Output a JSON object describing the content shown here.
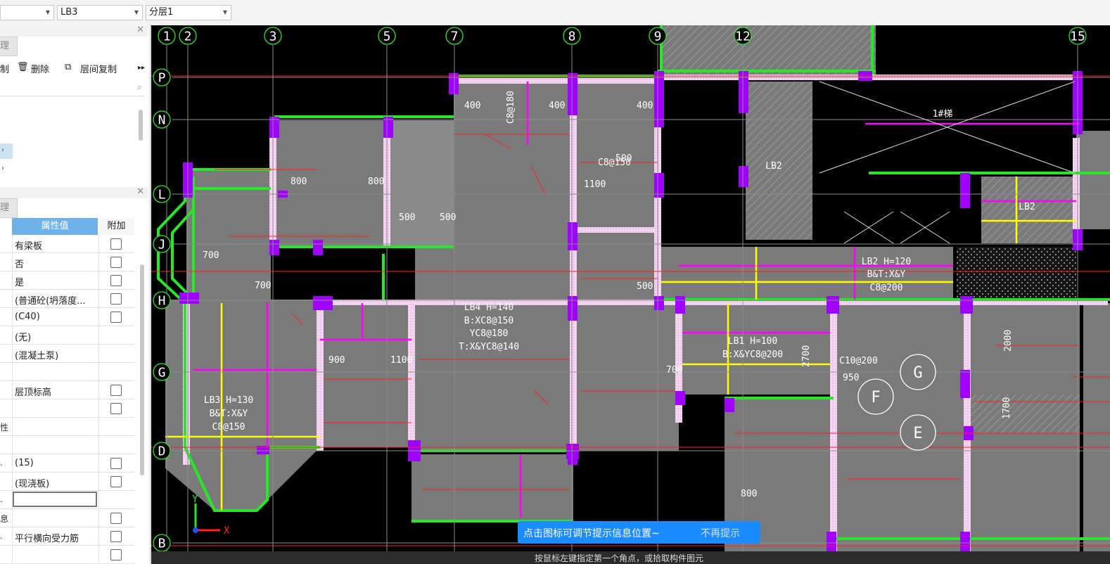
{
  "toolbar": {
    "dropdown1": "",
    "dropdown2": "LB3",
    "dropdown3": "分层1"
  },
  "left_panel": {
    "top_tab": "理",
    "actions": {
      "copy_partial": "制",
      "delete": "删除",
      "floor_copy": "层间复制"
    },
    "bottom_tab": "理",
    "grid_headers": {
      "value": "属性值",
      "extra": "附加"
    },
    "properties": [
      {
        "key": "",
        "value": "有梁板",
        "checkbox": true
      },
      {
        "key": "",
        "value": "否",
        "checkbox": true
      },
      {
        "key": "",
        "value": "是",
        "checkbox": true
      },
      {
        "key": "",
        "value": "(普通砼(坍落度...",
        "checkbox": true
      },
      {
        "key": "",
        "value": "(C40)",
        "checkbox": true
      },
      {
        "key": "",
        "value": "(无)",
        "checkbox": false
      },
      {
        "key": "",
        "value": "(混凝土泵)",
        "checkbox": false
      },
      {
        "key": "",
        "value": "",
        "checkbox": false
      },
      {
        "key": "",
        "value": "层顶标高",
        "checkbox": true
      },
      {
        "key": "",
        "value": "",
        "checkbox": true
      },
      {
        "key": "性",
        "value": "",
        "checkbox": false
      },
      {
        "key": "",
        "value": "",
        "checkbox": false
      },
      {
        "key": ".",
        "value": "(15)",
        "checkbox": true
      },
      {
        "key": "",
        "value": "(现浇板)",
        "checkbox": true
      },
      {
        "key": ".",
        "value": "",
        "checkbox": false
      },
      {
        "key": "息",
        "value": "",
        "checkbox": true
      },
      {
        "key": ".",
        "value": "平行横向受力筋",
        "checkbox": true
      },
      {
        "key": "",
        "value": "",
        "checkbox": true
      }
    ]
  },
  "canvas": {
    "axis_top": [
      "1",
      "2",
      "3",
      "5",
      "7",
      "8",
      "9",
      "12",
      "15"
    ],
    "axis_left": [
      "P",
      "N",
      "L",
      "J",
      "H",
      "G",
      "D",
      "B"
    ],
    "slab_labels": [
      "LB4 H=140",
      "B:XC8@150",
      "YC8@180",
      "T:X&YC8@140",
      "LB3 H=130",
      "B&T:X&Y",
      "C8@150",
      "LB1 H=100",
      "B:X&YC8@200",
      "LB2 H=120",
      "B&T:X&Y",
      "C8@200",
      "LB2",
      "LB2",
      "1#梯"
    ],
    "dims": [
      "400",
      "400",
      "400",
      "800",
      "800",
      "500",
      "500",
      "500",
      "700",
      "700",
      "900",
      "1100",
      "950",
      "2700",
      "2000",
      "1700",
      "C8@150",
      "C8@180",
      "C10@200",
      "800",
      "700",
      "500",
      "1100"
    ],
    "circle_labels": [
      "G",
      "F",
      "E"
    ],
    "axis_x_label": "X",
    "axis_y_label": "Y",
    "colors": {
      "slab": "#7a7a7a",
      "beam": "#27e827",
      "column": "#a000ff",
      "rebar": "#ff00ff",
      "dim": "#ff2020",
      "highlight": "#ffff00"
    }
  },
  "tip": {
    "text": "点击图标可调节提示信息位置~",
    "dismiss": "不再提示"
  },
  "status": {
    "text": "按鼠标左键指定第一个角点，或拾取构件图元"
  }
}
